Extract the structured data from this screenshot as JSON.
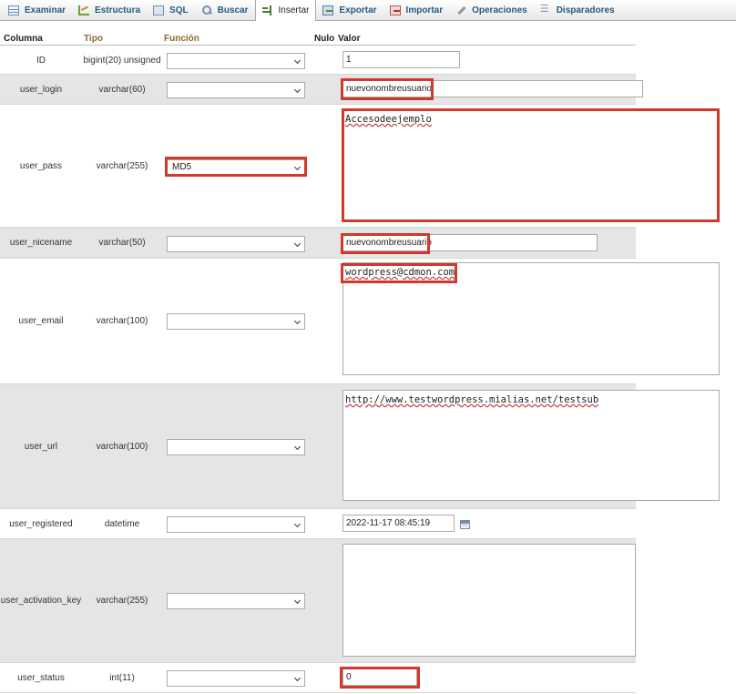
{
  "tabs": [
    {
      "label": "Examinar",
      "icon": "browse-icon",
      "active": false
    },
    {
      "label": "Estructura",
      "icon": "structure-icon",
      "active": false
    },
    {
      "label": "SQL",
      "icon": "sql-icon",
      "active": false
    },
    {
      "label": "Buscar",
      "icon": "search-icon",
      "active": false
    },
    {
      "label": "Insertar",
      "icon": "insert-icon",
      "active": true
    },
    {
      "label": "Exportar",
      "icon": "export-icon",
      "active": false
    },
    {
      "label": "Importar",
      "icon": "import-icon",
      "active": false
    },
    {
      "label": "Operaciones",
      "icon": "operations-icon",
      "active": false
    },
    {
      "label": "Disparadores",
      "icon": "triggers-icon",
      "active": false
    }
  ],
  "table_header": {
    "columna": "Columna",
    "tipo": "Tipo",
    "funcion": "Función",
    "nulo": "Nulo",
    "valor": "Valor"
  },
  "rows": [
    {
      "name": "ID",
      "type": "bigint(20) unsigned",
      "function": "",
      "value": "1"
    },
    {
      "name": "user_login",
      "type": "varchar(60)",
      "function": "",
      "value": "nuevonombreusuario"
    },
    {
      "name": "user_pass",
      "type": "varchar(255)",
      "function": "MD5",
      "value": "Accesodeejemplo"
    },
    {
      "name": "user_nicename",
      "type": "varchar(50)",
      "function": "",
      "value": "nuevonombreusuario"
    },
    {
      "name": "user_email",
      "type": "varchar(100)",
      "function": "",
      "value": "wordpress@cdmon.com"
    },
    {
      "name": "user_url",
      "type": "varchar(100)",
      "function": "",
      "value": "http://www.testwordpress.mialias.net/testsub"
    },
    {
      "name": "user_registered",
      "type": "datetime",
      "function": "",
      "value": "2022-11-17 08:45:19"
    },
    {
      "name": "user_activation_key",
      "type": "varchar(255)",
      "function": "",
      "value": ""
    },
    {
      "name": "user_status",
      "type": "int(11)",
      "function": "",
      "value": "0"
    }
  ],
  "colors": {
    "highlight": "#d0392b",
    "row_alt": "#e5e5e5",
    "link": "#235a81"
  }
}
